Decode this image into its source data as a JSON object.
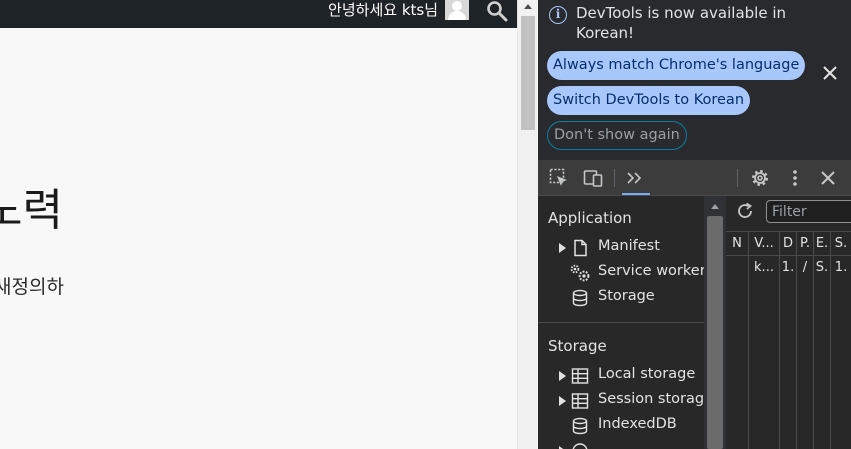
{
  "page": {
    "greeting": "안녕하세요 kts님",
    "heading": "노력",
    "subtext": "새정의하"
  },
  "infobar": {
    "message": "DevTools is now available in Korean!",
    "always_match": "Always match Chrome's language",
    "switch_korean": "Switch DevTools to Korean",
    "dont_show": "Don't show again"
  },
  "sidebar": {
    "application_header": "Application",
    "application_items": [
      {
        "label": "Manifest",
        "icon": "file-icon"
      },
      {
        "label": "Service workers",
        "icon": "gears-icon"
      },
      {
        "label": "Storage",
        "icon": "database-icon"
      }
    ],
    "storage_header": "Storage",
    "storage_items": [
      {
        "label": "Local storage",
        "icon": "table-icon"
      },
      {
        "label": "Session storage",
        "icon": "table-icon"
      },
      {
        "label": "IndexedDB",
        "icon": "database-icon"
      }
    ]
  },
  "main": {
    "filter_placeholder": "Filter",
    "columns": [
      {
        "header": "N",
        "cell": ""
      },
      {
        "header": "V...",
        "cell": "k..."
      },
      {
        "header": "D",
        "cell": "1."
      },
      {
        "header": "P.",
        "cell": "/"
      },
      {
        "header": "E.",
        "cell": "S."
      },
      {
        "header": "S.",
        "cell": "1."
      }
    ]
  },
  "colors": {
    "accent": "#a8c7fa",
    "topbar": "#1e2328",
    "devtools_bg": "#282828"
  }
}
